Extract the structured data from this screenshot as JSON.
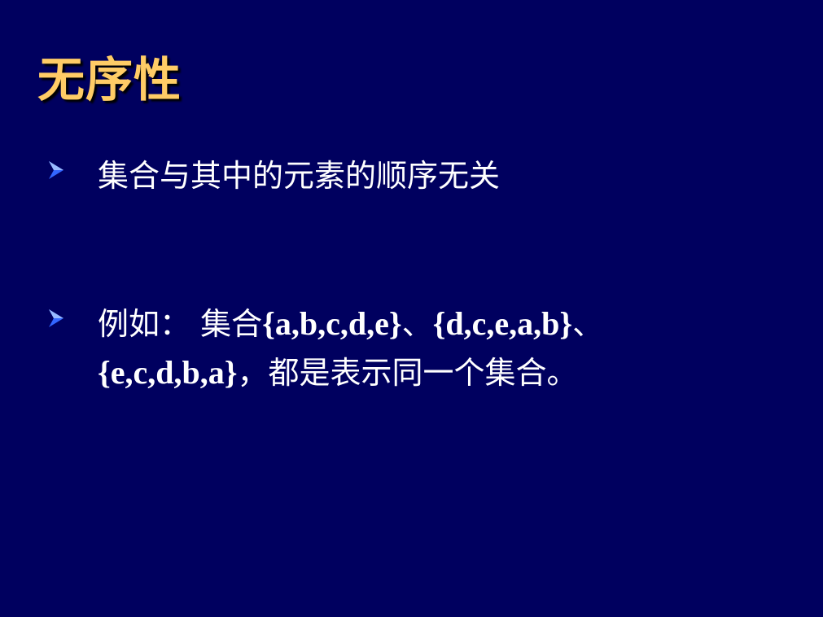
{
  "slide": {
    "title": "无序性",
    "bullets": [
      {
        "icon": "arrow-bullet-icon",
        "text": "集合与其中的元素的顺序无关"
      },
      {
        "icon": "arrow-bullet-icon",
        "prefix": "例如：  集合",
        "set1": "{a,b,c,d,e}",
        "sep1": "、",
        "set2": "{d,c,e,a,b}",
        "sep2": "、",
        "set3": "{e,c,d,b,a}",
        "suffix": "，都是表示同一个集合。"
      }
    ]
  },
  "colors": {
    "background": "#00005f",
    "title": "#ffcc66",
    "text": "#ffffff",
    "bullet": "#3366ff"
  }
}
